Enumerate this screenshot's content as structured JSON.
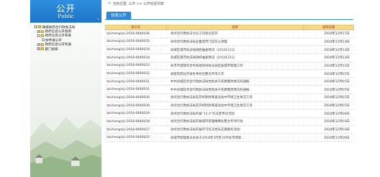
{
  "sidebar": {
    "title": "公开",
    "subtitle": "Public",
    "corner": "↘",
    "tree": [
      {
        "label": "镇城县综合行政执法局",
        "level": 1,
        "toggle": "-",
        "kind": "folder"
      },
      {
        "label": "政府信息公开指南",
        "level": 2,
        "toggle": "+",
        "kind": "folder"
      },
      {
        "label": "政府信息公开目录",
        "level": 2,
        "toggle": "-",
        "kind": "folder"
      },
      {
        "label": "依申请公开",
        "level": 3,
        "toggle": "",
        "kind": "doc"
      },
      {
        "label": "政府信息公开年报",
        "level": 2,
        "toggle": "+",
        "kind": "folder"
      },
      {
        "label": "部门规章",
        "level": 2,
        "toggle": "+",
        "kind": "folder"
      }
    ]
  },
  "breadcrumb": {
    "icon": "➜",
    "text": "当前位置: 公开 >> 公开信息列表"
  },
  "tab": {
    "label": "信息公开"
  },
  "table": {
    "headers": [
      "索引号",
      "名称",
      "发布日期"
    ],
    "rows": [
      [
        "taicheng(zj)-2018-0000036",
        "县综合行政执法大队工作会议召开",
        "2018年12月17日"
      ],
      [
        "taicheng(zj)-2018-0000035",
        "县综合行政执法局正面宣传门前灰尘清理",
        "2018年12月13日"
      ],
      [
        "taicheng(zj)-2018-0000034",
        "县城区城市执法局随机抽查情况（20181212）",
        "2018年12月13日"
      ],
      [
        "taicheng(zj)-2018-0000034",
        "县城区城市执法局随机抽查情况（20181212）",
        "2018年12月13日"
      ],
      [
        "taicheng(zj)-2018-0000033",
        "县市市城管综合考核组到县执法局检查城市管理工作",
        "2018年12月12日"
      ],
      [
        "taicheng(zj)-2018-0000032",
        "县医院周边开展冬季综合整治专项工作",
        "2018年12月07日"
      ],
      [
        "taicheng(zj)-2018-0000031",
        "中共县城区综合行政执法局党组关于巡察整改情况的通报",
        "2018年12月07日"
      ],
      [
        "taicheng(zj)-2018-0000031",
        "中共县城区综合行政执法局党组关于巡察整改情况的通报",
        "2018年12月07日"
      ],
      [
        "taicheng(zj)-2018-0000030",
        "县综合行政执法局召开机制改革座谈会中环境卫生保洁工作",
        "2018年12月07日"
      ],
      [
        "taicheng(zj)-2018-0000030",
        "县综合行政执法局召开机制改革座谈会中环境卫生保洁工作",
        "2018年12月07日"
      ],
      [
        "taicheng(zj)-2018-0000029",
        "县综合行政执法局开展“12.4”宪法宣传日活动",
        "2018年12月04日"
      ],
      [
        "taicheng(zj)-2018-0000028",
        "县综合行政执法局开展城市管理精细化整治专项行动",
        "2018年12月03日"
      ],
      [
        "taicheng(zj)-2018-0000027",
        "县综合行政执法局开展学习宪法党员志愿服务活动",
        "2018年12月03日"
      ],
      [
        "taicheng(zj)-2018-0000025",
        "县城市管理委员会关于2018年3月至10月份市场管…",
        "2018年11月28日"
      ]
    ]
  },
  "colors": {
    "header_blue": "#1c74c9",
    "tab_blue": "#2e8ad8",
    "th_bg": "#f5d98a",
    "th_text": "#b22222"
  }
}
